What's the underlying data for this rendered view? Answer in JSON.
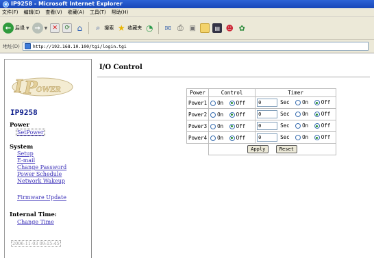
{
  "window": {
    "title": "IP9258 - Microsoft Internet Explorer"
  },
  "menu": [
    "文件(F)",
    "编辑(E)",
    "查看(V)",
    "收藏(A)",
    "工具(T)",
    "帮助(H)"
  ],
  "toolbar": {
    "back_label": "后退",
    "search_label": "搜索",
    "favorites_label": "收藏夹"
  },
  "address": {
    "label": "地址(D)",
    "url": "http://192.168.10.100/tgi/login.tgi"
  },
  "sidebar": {
    "device_name": "IP9258",
    "power_heading": "Power",
    "set_power": "SetPower",
    "system_heading": "System",
    "system_links": [
      "Setup",
      "E-mail",
      "Change Password",
      "Power Schedule",
      "Network Wakeup"
    ],
    "firmware_update": "Firmware Update",
    "internal_time_heading": "Internal Time:",
    "change_time": "Change Time",
    "timestamp": "2006-11-03 09:15:45"
  },
  "main": {
    "title": "I/O Control",
    "headers": {
      "power": "Power",
      "control": "Control",
      "timer": "Timer"
    },
    "rows": [
      {
        "name": "Power1",
        "on": "On",
        "off": "Off",
        "control_state": "off",
        "timer_value": "0",
        "sec": "Sec",
        "t_on": "On",
        "t_off": "Off",
        "timer_state": "off"
      },
      {
        "name": "Power2",
        "on": "On",
        "off": "Off",
        "control_state": "off",
        "timer_value": "0",
        "sec": "Sec",
        "t_on": "On",
        "t_off": "Off",
        "timer_state": "off"
      },
      {
        "name": "Power3",
        "on": "On",
        "off": "Off",
        "control_state": "off",
        "timer_value": "0",
        "sec": "Sec",
        "t_on": "On",
        "t_off": "Off",
        "timer_state": "off"
      },
      {
        "name": "Power4",
        "on": "On",
        "off": "Off",
        "control_state": "off",
        "timer_value": "0",
        "sec": "Sec",
        "t_on": "On",
        "t_off": "Off",
        "timer_state": "off"
      }
    ],
    "apply_label": "Apply",
    "reset_label": "Reset"
  }
}
